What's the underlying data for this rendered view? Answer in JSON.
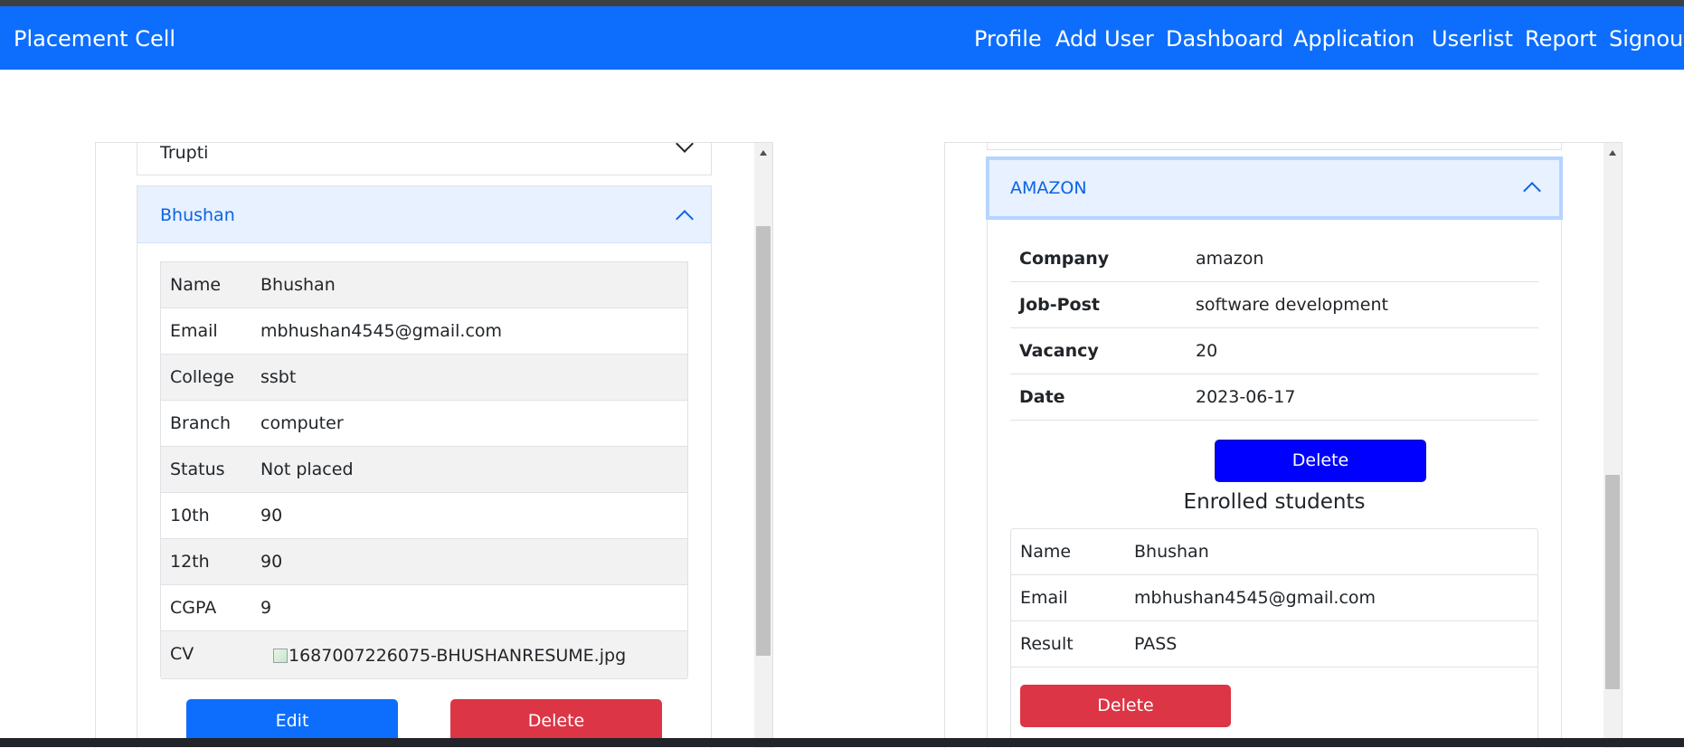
{
  "navbar": {
    "brand": "Placement Cell",
    "links": [
      "Profile",
      "Add User",
      "Dashboard",
      "Application",
      "Userlist",
      "Report",
      "Signout"
    ]
  },
  "left_panel": {
    "collapsed_item": "Trupti",
    "expanded_item": {
      "title": "Bhushan",
      "rows": [
        {
          "label": "Name",
          "value": "Bhushan"
        },
        {
          "label": "Email",
          "value": "mbhushan4545@gmail.com"
        },
        {
          "label": "College",
          "value": "ssbt"
        },
        {
          "label": "Branch",
          "value": "computer"
        },
        {
          "label": "Status",
          "value": "Not placed"
        },
        {
          "label": "10th",
          "value": "90"
        },
        {
          "label": "12th",
          "value": "90"
        },
        {
          "label": "CGPA",
          "value": "9"
        },
        {
          "label": "CV",
          "value": "1687007226075-BHUSHANRESUME.jpg"
        }
      ],
      "edit_label": "Edit",
      "delete_label": "Delete"
    }
  },
  "right_panel": {
    "expanded_item": {
      "title": "AMAZON",
      "rows": [
        {
          "label": "Company",
          "value": "amazon"
        },
        {
          "label": "Job-Post",
          "value": "software development"
        },
        {
          "label": "Vacancy",
          "value": "20"
        },
        {
          "label": "Date",
          "value": "2023-06-17"
        }
      ],
      "delete_label": "Delete",
      "enrolled_heading": "Enrolled students",
      "enrolled_rows": [
        {
          "label": "Name",
          "value": "Bhushan"
        },
        {
          "label": "Email",
          "value": "mbhushan4545@gmail.com"
        },
        {
          "label": "Result",
          "value": "PASS"
        }
      ],
      "enrolled_delete_label": "Delete"
    }
  },
  "colors": {
    "navbar": "#0d6efd",
    "accordion_active_bg": "#e7f1ff",
    "accordion_active_text": "#0c63e4",
    "danger": "#dc3545",
    "blue_button": "#0000ff"
  }
}
